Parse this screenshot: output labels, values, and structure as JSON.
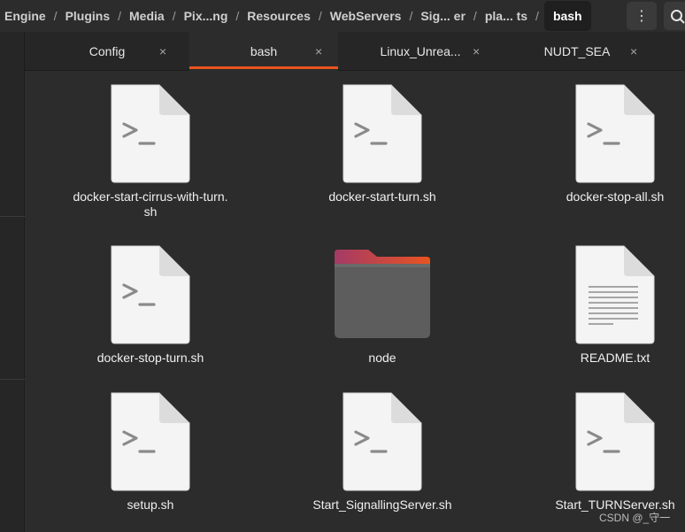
{
  "breadcrumb": [
    "Engine",
    "Plugins",
    "Media",
    "Pix...ng",
    "Resources",
    "WebServers",
    "Sig... er",
    "pla... ts",
    "bash"
  ],
  "breadcrumb_separator": "/",
  "header": {
    "menu_glyph": "⋮"
  },
  "tabs": [
    {
      "label": "Config",
      "active": false,
      "close": "×"
    },
    {
      "label": "bash",
      "active": true,
      "close": "×"
    },
    {
      "label": "Linux_Unrea...",
      "active": false,
      "close": "×"
    },
    {
      "label": "NUDT_SEA",
      "active": false,
      "close": "×"
    }
  ],
  "files": [
    {
      "name": "docker-start-cirrus-with-turn.\nsh",
      "kind": "script"
    },
    {
      "name": "docker-start-turn.sh",
      "kind": "script"
    },
    {
      "name": "docker-stop-all.sh",
      "kind": "script"
    },
    {
      "name": "docker-stop-turn.sh",
      "kind": "script"
    },
    {
      "name": "node",
      "kind": "folder"
    },
    {
      "name": "README.txt",
      "kind": "text"
    },
    {
      "name": "setup.sh",
      "kind": "script"
    },
    {
      "name": "Start_SignallingServer.sh",
      "kind": "script"
    },
    {
      "name": "Start_TURNServer.sh",
      "kind": "script"
    }
  ],
  "watermark": "CSDN @_守一",
  "colors": {
    "accent": "#e95420",
    "folder_top": "#a43a66",
    "folder_body": "#5d5d5d"
  }
}
